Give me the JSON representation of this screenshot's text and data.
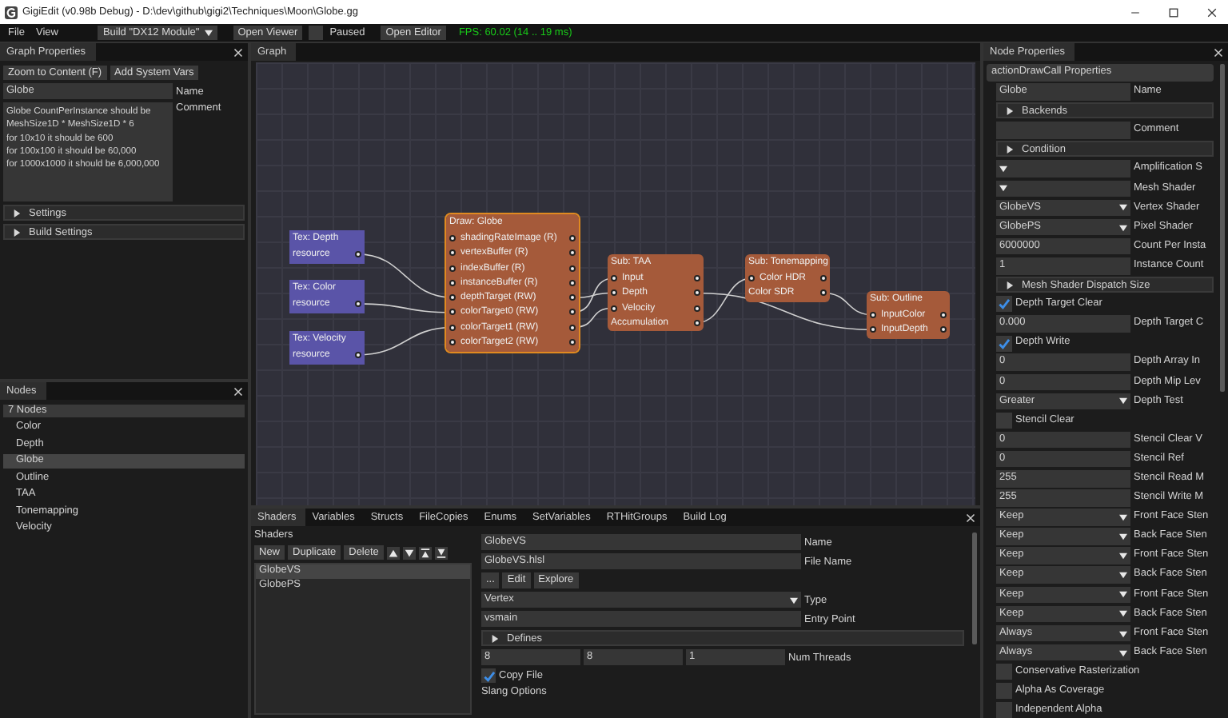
{
  "window": {
    "title": "GigiEdit (v0.98b Debug) - D:\\dev\\github\\gigi2\\Techniques\\Moon\\Globe.gg"
  },
  "menu": [
    "File",
    "View"
  ],
  "toolbar": {
    "build_dropdown": "Build \"DX12 Module\"",
    "open_viewer": "Open Viewer",
    "paused": {
      "label": "Paused",
      "checked": false
    },
    "open_editor": "Open Editor",
    "fps": "FPS: 60.02 (14 .. 19 ms)"
  },
  "graph_properties": {
    "title": "Graph Properties",
    "buttons": [
      "Zoom to Content (F)",
      "Add System Vars"
    ],
    "name": {
      "value": "Globe",
      "label": "Name"
    },
    "comment": {
      "value": "Globe CountPerInstance should be\nMeshSize1D * MeshSize1D * 6\nfor 10x10 it should be 600\nfor 100x100 it should be 60,000\nfor 1000x1000 it should be 6,000,000",
      "label": "Comment"
    },
    "sections": [
      {
        "label": "Settings",
        "expanded": false
      },
      {
        "label": "Build Settings",
        "expanded": false
      }
    ]
  },
  "nodes_panel": {
    "title": "Nodes",
    "header": "7 Nodes",
    "items": [
      {
        "label": "Color",
        "selected": false
      },
      {
        "label": "Depth",
        "selected": false
      },
      {
        "label": "Globe",
        "selected": true
      },
      {
        "label": "Outline",
        "selected": false
      },
      {
        "label": "TAA",
        "selected": false
      },
      {
        "label": "Tonemapping",
        "selected": false
      },
      {
        "label": "Velocity",
        "selected": false
      }
    ]
  },
  "graph": {
    "title": "Graph",
    "nodes": [
      {
        "kind": "texture",
        "title": "Tex: Depth",
        "selected": false,
        "pins": [
          {
            "label": "resource",
            "in": false,
            "out": true
          }
        ]
      },
      {
        "kind": "texture",
        "title": "Tex: Color",
        "selected": false,
        "pins": [
          {
            "label": "resource",
            "in": false,
            "out": true
          }
        ]
      },
      {
        "kind": "texture",
        "title": "Tex: Velocity",
        "selected": false,
        "pins": [
          {
            "label": "resource",
            "in": false,
            "out": true
          }
        ]
      },
      {
        "kind": "action",
        "title": "Draw: Globe",
        "selected": true,
        "pins": [
          {
            "label": "shadingRateImage (R)",
            "in": true,
            "out": true
          },
          {
            "label": "vertexBuffer (R)",
            "in": true,
            "out": true
          },
          {
            "label": "indexBuffer (R)",
            "in": true,
            "out": true
          },
          {
            "label": "instanceBuffer (R)",
            "in": true,
            "out": true
          },
          {
            "label": "depthTarget (RW)",
            "in": true,
            "out": true
          },
          {
            "label": "colorTarget0 (RW)",
            "in": true,
            "out": true
          },
          {
            "label": "colorTarget1 (RW)",
            "in": true,
            "out": true
          },
          {
            "label": "colorTarget2 (RW)",
            "in": true,
            "out": true
          }
        ]
      },
      {
        "kind": "action",
        "title": "Sub: TAA",
        "selected": false,
        "pins": [
          {
            "label": "Input",
            "in": true,
            "out": true
          },
          {
            "label": "Depth",
            "in": true,
            "out": true
          },
          {
            "label": "Velocity",
            "in": true,
            "out": true
          },
          {
            "label": "Accumulation",
            "in": false,
            "out": true
          }
        ]
      },
      {
        "kind": "action",
        "title": "Sub: Tonemapping",
        "selected": false,
        "pins": [
          {
            "label": "Color HDR",
            "in": true,
            "out": true
          },
          {
            "label": "Color SDR",
            "in": false,
            "out": true
          }
        ]
      },
      {
        "kind": "action",
        "title": "Sub: Outline",
        "selected": false,
        "pins": [
          {
            "label": "InputColor",
            "in": true,
            "out": true
          },
          {
            "label": "InputDepth",
            "in": true,
            "out": true
          }
        ]
      }
    ]
  },
  "bottom_panel": {
    "tabs": [
      {
        "label": "Shaders",
        "selected": true
      },
      {
        "label": "Variables",
        "selected": false
      },
      {
        "label": "Structs",
        "selected": false
      },
      {
        "label": "FileCopies",
        "selected": false
      },
      {
        "label": "Enums",
        "selected": false
      },
      {
        "label": "SetVariables",
        "selected": false
      },
      {
        "label": "RTHitGroups",
        "selected": false
      },
      {
        "label": "Build Log",
        "selected": false
      }
    ],
    "shaders": {
      "label": "Shaders",
      "buttons": [
        "New",
        "Duplicate",
        "Delete"
      ],
      "items": [
        {
          "label": "GlobeVS",
          "selected": true
        },
        {
          "label": "GlobePS",
          "selected": false
        }
      ]
    },
    "form": {
      "name": {
        "value": "GlobeVS",
        "label": "Name"
      },
      "file_name": {
        "value": "GlobeVS.hlsl",
        "label": "File Name"
      },
      "file_buttons": [
        "...",
        "Edit",
        "Explore"
      ],
      "type": {
        "value": "Vertex",
        "label": "Type"
      },
      "entry_point": {
        "value": "vsmain",
        "label": "Entry Point"
      },
      "defines": {
        "label": "Defines",
        "expanded": false
      },
      "num_threads": {
        "values": [
          "8",
          "8",
          "1"
        ],
        "label": "Num Threads"
      },
      "copy_file": {
        "label": "Copy File",
        "checked": true
      },
      "slang_options": "Slang Options"
    }
  },
  "node_properties": {
    "title": "Node Properties",
    "header": "actionDrawCall Properties",
    "rows": [
      {
        "kind": "text",
        "value": "Globe",
        "label": "Name"
      },
      {
        "kind": "collapse",
        "text": "Backends",
        "expanded": false
      },
      {
        "kind": "text",
        "label": "Comment"
      },
      {
        "kind": "collapse",
        "text": "Condition",
        "expanded": false
      },
      {
        "kind": "dropdown",
        "label": "Amplification S"
      },
      {
        "kind": "dropdown",
        "label": "Mesh Shader"
      },
      {
        "kind": "dropdown",
        "value": "GlobeVS",
        "label": "Vertex Shader"
      },
      {
        "kind": "dropdown",
        "value": "GlobePS",
        "label": "Pixel Shader"
      },
      {
        "kind": "text",
        "value": "6000000",
        "label": "Count Per Insta"
      },
      {
        "kind": "text",
        "value": "1",
        "label": "Instance Count"
      },
      {
        "kind": "collapse",
        "text": "Mesh Shader Dispatch Size",
        "expanded": false
      },
      {
        "kind": "checkbox",
        "text": "Depth Target Clear",
        "checked": true
      },
      {
        "kind": "text",
        "value": "0.000",
        "label": "Depth Target C"
      },
      {
        "kind": "checkbox",
        "text": "Depth Write",
        "checked": true
      },
      {
        "kind": "text",
        "value": "0",
        "label": "Depth Array In"
      },
      {
        "kind": "text",
        "value": "0",
        "label": "Depth Mip Lev"
      },
      {
        "kind": "dropdown",
        "value": "Greater",
        "label": "Depth Test"
      },
      {
        "kind": "checkbox",
        "text": "Stencil Clear",
        "checked": false
      },
      {
        "kind": "text",
        "value": "0",
        "label": "Stencil Clear V"
      },
      {
        "kind": "text",
        "value": "0",
        "label": "Stencil Ref"
      },
      {
        "kind": "text",
        "value": "255",
        "label": "Stencil Read M"
      },
      {
        "kind": "text",
        "value": "255",
        "label": "Stencil Write M"
      },
      {
        "kind": "dropdown",
        "value": "Keep",
        "label": "Front Face Sten"
      },
      {
        "kind": "dropdown",
        "value": "Keep",
        "label": "Back Face Sten"
      },
      {
        "kind": "dropdown",
        "value": "Keep",
        "label": "Front Face Sten"
      },
      {
        "kind": "dropdown",
        "value": "Keep",
        "label": "Back Face Sten"
      },
      {
        "kind": "dropdown",
        "value": "Keep",
        "label": "Front Face Sten"
      },
      {
        "kind": "dropdown",
        "value": "Keep",
        "label": "Back Face Sten"
      },
      {
        "kind": "dropdown",
        "value": "Always",
        "label": "Front Face Sten"
      },
      {
        "kind": "dropdown",
        "value": "Always",
        "label": "Back Face Sten"
      },
      {
        "kind": "checkbox",
        "text": "Conservative Rasterization",
        "checked": false
      },
      {
        "kind": "checkbox",
        "text": "Alpha As Coverage",
        "checked": false
      },
      {
        "kind": "checkbox",
        "text": "Independent Alpha",
        "checked": false
      }
    ]
  }
}
